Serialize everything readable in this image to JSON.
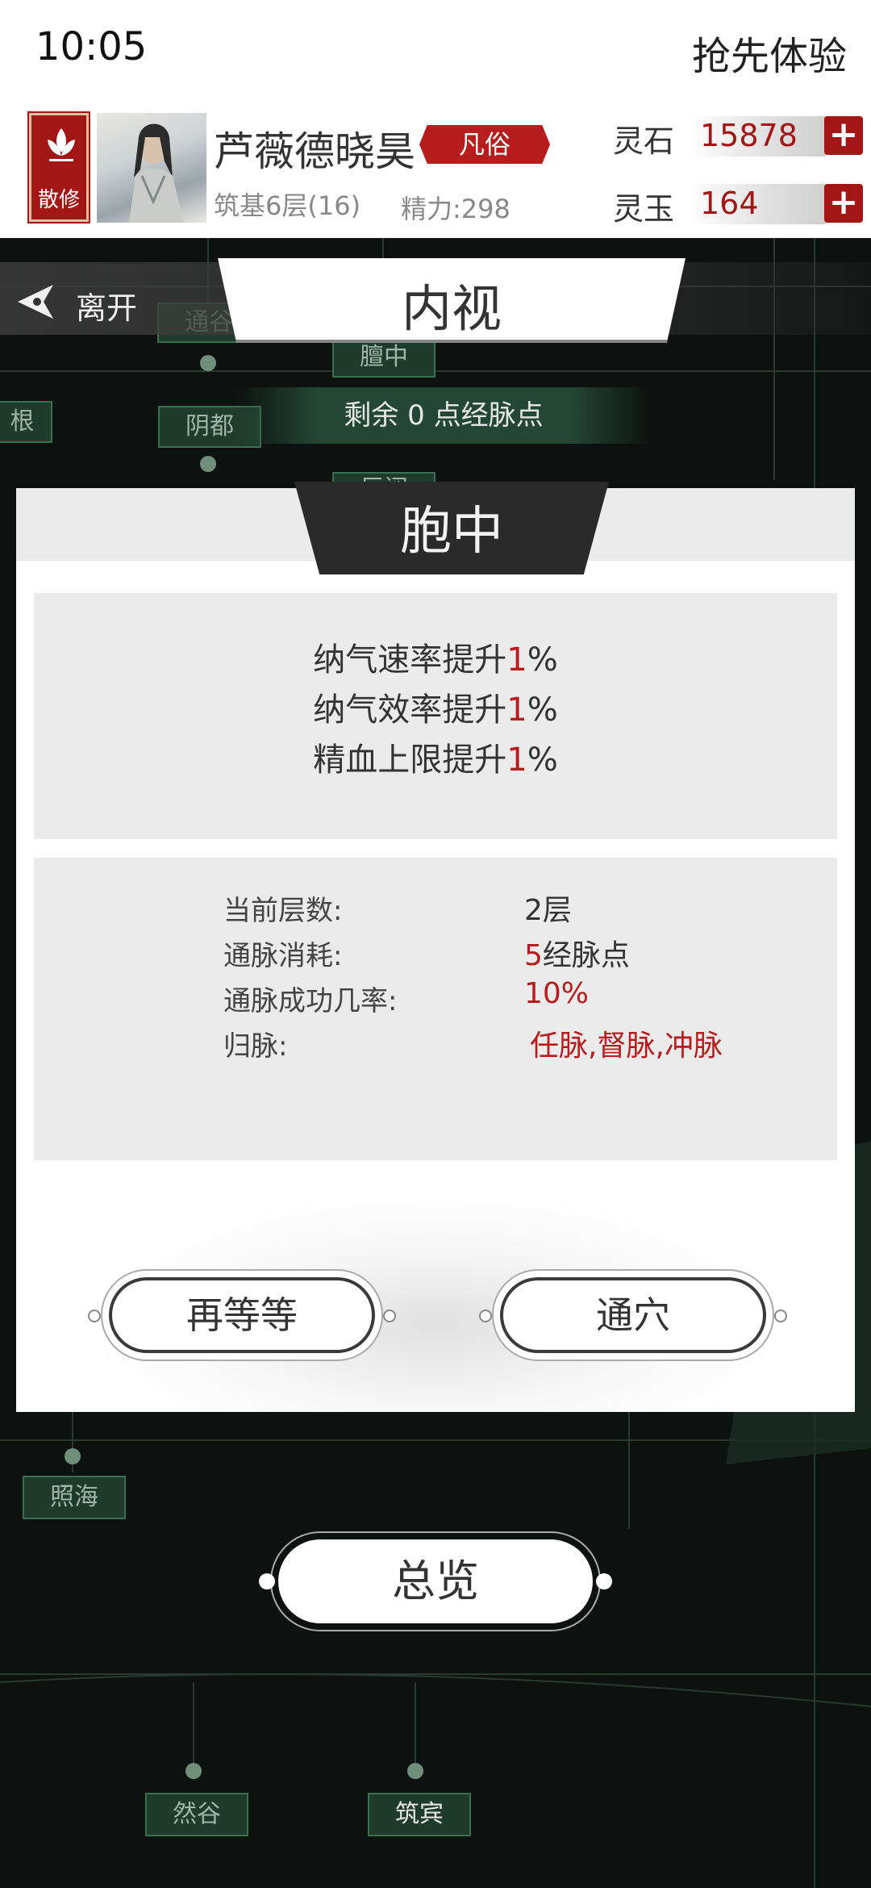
{
  "status_bar": {
    "time": "10:05",
    "early_access": "抢先体验"
  },
  "player": {
    "sect": "散修",
    "name": "芦薇德晓昊",
    "rank": "凡俗",
    "realm": "筑基6层(16)",
    "energy": "精力:298"
  },
  "currencies": [
    {
      "label": "灵石",
      "value": "15878",
      "plus": "+"
    },
    {
      "label": "灵玉",
      "value": "164",
      "plus": "+"
    }
  ],
  "nav": {
    "leave": "离开",
    "title": "内视"
  },
  "remaining_points": "剩余 0 点经脉点",
  "map_nodes": [
    "通谷",
    "膻中",
    "根",
    "阴都",
    "巨阙",
    "照海",
    "然谷",
    "筑宾"
  ],
  "acupoint": {
    "name": "胞中",
    "effects": [
      {
        "prefix": "纳气速率提升",
        "value": "1",
        "suffix": "%"
      },
      {
        "prefix": "纳气效率提升",
        "value": "1",
        "suffix": "%"
      },
      {
        "prefix": "精血上限提升",
        "value": "1",
        "suffix": "%"
      }
    ],
    "stats": {
      "level_label": "当前层数:",
      "level_value": "2层",
      "cost_label": "通脉消耗:",
      "cost_value": "5",
      "cost_unit": "经脉点",
      "success_label": "通脉成功几率:",
      "success_value": "10%",
      "meridian_label": "归脉:",
      "meridian_value": "任脉,督脉,冲脉"
    }
  },
  "buttons": {
    "wait": "再等等",
    "open": "通穴",
    "overview": "总览"
  },
  "colors": {
    "accent_red": "#b81d1d",
    "map_node": "#1f3b2c",
    "panel_gray": "#ebebeb"
  }
}
